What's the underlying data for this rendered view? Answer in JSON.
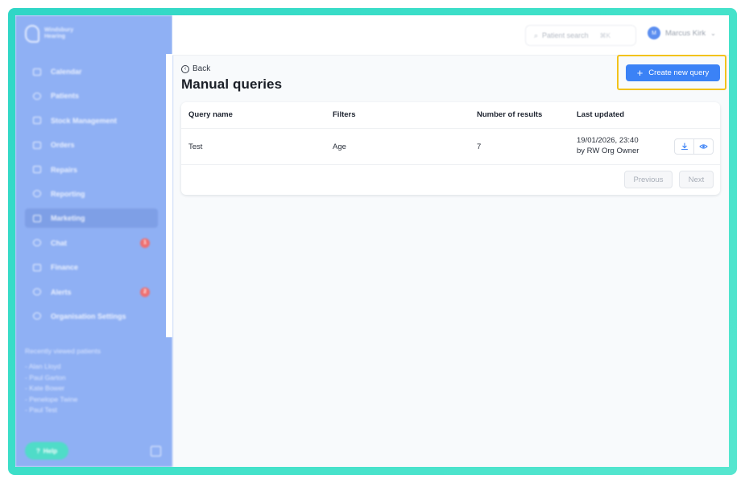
{
  "brand": {
    "name_line1": "Windsbury",
    "name_line2": "Hearing"
  },
  "sidebar": {
    "items": [
      {
        "label": "Calendar",
        "icon": "calendar-icon"
      },
      {
        "label": "Patients",
        "icon": "user-icon"
      },
      {
        "label": "Stock Management",
        "icon": "box-icon"
      },
      {
        "label": "Orders",
        "icon": "clipboard-icon"
      },
      {
        "label": "Repairs",
        "icon": "wrench-icon"
      },
      {
        "label": "Reporting",
        "icon": "chart-icon"
      },
      {
        "label": "Marketing",
        "icon": "mail-icon",
        "active": true
      },
      {
        "label": "Chat",
        "icon": "chat-icon",
        "badge": "1"
      },
      {
        "label": "Finance",
        "icon": "card-icon"
      },
      {
        "label": "Alerts",
        "icon": "bell-icon",
        "badge": "2"
      },
      {
        "label": "Organisation Settings",
        "icon": "gear-icon"
      }
    ],
    "recent_header": "Recently viewed patients",
    "recent": [
      "- Alan Lloyd",
      "- Paul Garton",
      "- Kate Bower",
      "- Penelope Twine",
      "- Paul Test"
    ],
    "help_label": "Help"
  },
  "topbar": {
    "search_placeholder": "Patient search",
    "search_shortcut": "⌘K",
    "user_initials": "M",
    "user_name": "Marcus Kirk"
  },
  "page": {
    "back_label": "Back",
    "title": "Manual queries",
    "create_label": "Create new query"
  },
  "table": {
    "columns": [
      "Query name",
      "Filters",
      "Number of results",
      "Last updated"
    ],
    "rows": [
      {
        "name": "Test",
        "filters": "Age",
        "results": "7",
        "updated": "19/01/2026, 23:40",
        "by": "by RW Org Owner"
      }
    ],
    "prev_label": "Previous",
    "next_label": "Next"
  },
  "colors": {
    "accent": "#3b82f6",
    "sidebar": "#8fb0f4",
    "highlight": "#f2c21b",
    "frame": "#3ee0c8"
  }
}
